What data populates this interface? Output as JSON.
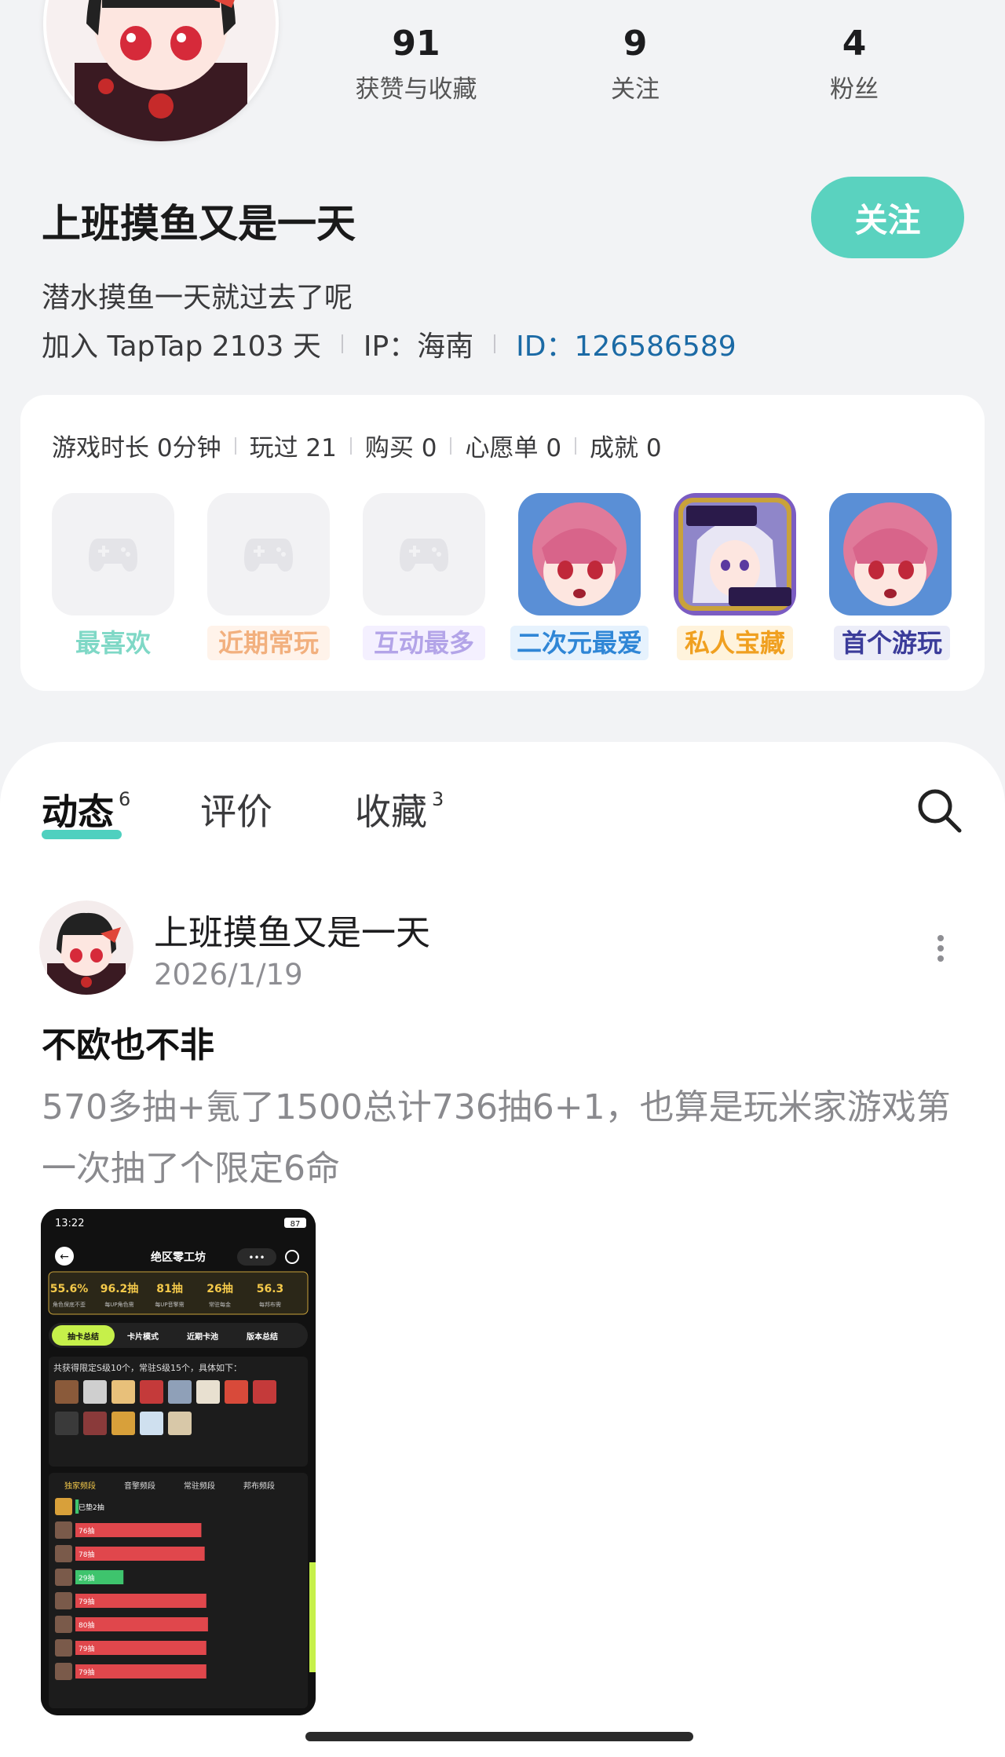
{
  "profile": {
    "stats": [
      {
        "value": "91",
        "label": "获赞与收藏"
      },
      {
        "value": "9",
        "label": "关注"
      },
      {
        "value": "4",
        "label": "粉丝"
      }
    ],
    "username": "上班摸鱼又是一天",
    "follow_label": "关注",
    "bio": "潜水摸鱼一天就过去了呢",
    "joined": "加入 TapTap 2103 天",
    "ip": "IP：海南",
    "id": "ID：126586589"
  },
  "games": {
    "stats": [
      "游戏时长 0分钟",
      "玩过 21",
      "购买 0",
      "心愿单 0",
      "成就 0"
    ],
    "slots": [
      {
        "label": "最喜欢",
        "color": "#7fd8c6",
        "bg": "#ffffff",
        "icon": "gamepad-icon"
      },
      {
        "label": "近期常玩",
        "color": "#f2b07e",
        "bg": "#fff3ea",
        "icon": "gamepad-icon"
      },
      {
        "label": "互动最多",
        "color": "#b3a4e8",
        "bg": "#f4f0ff",
        "icon": "gamepad-icon"
      },
      {
        "label": "二次元最爱",
        "color": "#2f86d6",
        "bg": "#e6f2fd",
        "icon": "anime-game-icon"
      },
      {
        "label": "私人宝藏",
        "color": "#f0a020",
        "bg": "#fff3dc",
        "icon": "isekai-game-icon"
      },
      {
        "label": "首个游玩",
        "color": "#3b3c9a",
        "bg": "#ecedf8",
        "icon": "anime-game-icon"
      }
    ]
  },
  "tabs": [
    {
      "label": "动态",
      "count": "6"
    },
    {
      "label": "评价",
      "count": ""
    },
    {
      "label": "收藏",
      "count": "3"
    }
  ],
  "post": {
    "user": "上班摸鱼又是一天",
    "date": "2026/1/19",
    "title": "不欧也不非",
    "body": "570多抽+氪了1500总计736抽6+1，也算是玩米家游戏第一次抽了个限定6命",
    "screenshot": {
      "time": "13:22",
      "battery": "87",
      "title": "绝区零工坊",
      "stats": [
        {
          "value": "55.6%",
          "label": "角色保底不歪"
        },
        {
          "value": "96.2抽",
          "label": "每UP角色需"
        },
        {
          "value": "81抽",
          "label": "每UP音擎需"
        },
        {
          "value": "26抽",
          "label": "常驻每金"
        },
        {
          "value": "56.3",
          "label": "每邦布需"
        }
      ],
      "tabs": [
        "抽卡总结",
        "卡片模式",
        "近期卡池",
        "版本总结"
      ],
      "summary": "共获得限定S级10个，常驻S级15个，具体如下：",
      "pool_tabs": [
        "独家频段",
        "音擎频段",
        "常驻频段",
        "邦布频段"
      ],
      "pulls": [
        {
          "text": "已垫2抽",
          "value": 2,
          "color": "#3ec46d"
        },
        {
          "text": "76抽",
          "value": 76,
          "color": "#e0474c"
        },
        {
          "text": "78抽",
          "value": 78,
          "color": "#e0474c"
        },
        {
          "text": "29抽",
          "value": 29,
          "color": "#3ec46d"
        },
        {
          "text": "79抽",
          "value": 79,
          "color": "#e0474c"
        },
        {
          "text": "80抽",
          "value": 80,
          "color": "#e0474c"
        },
        {
          "text": "79抽",
          "value": 79,
          "color": "#e0474c"
        },
        {
          "text": "79抽",
          "value": 79,
          "color": "#e0474c"
        }
      ]
    }
  },
  "colors": {
    "accent": "#5ad2bf",
    "id_link": "#1b6aa5"
  }
}
